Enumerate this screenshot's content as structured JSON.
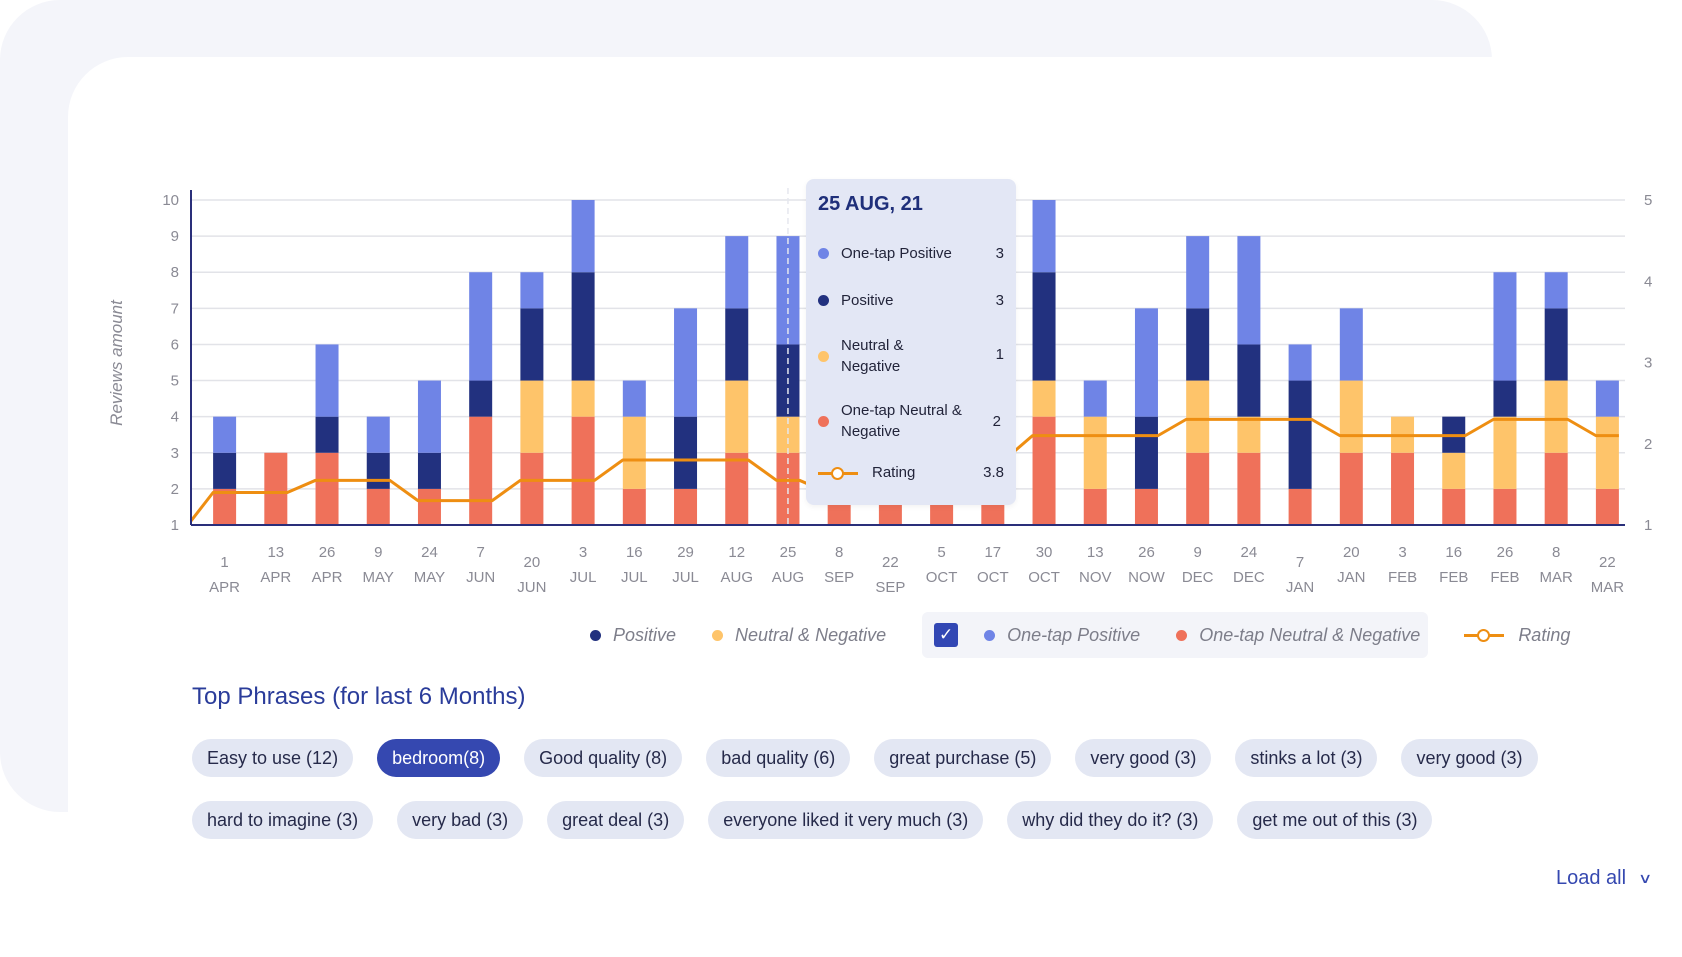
{
  "chart_data": {
    "type": "bar",
    "stacked": true,
    "ylabel": "Reviews amount",
    "ylim": [
      1,
      10
    ],
    "yticks": [
      1,
      2,
      3,
      4,
      5,
      6,
      7,
      8,
      9,
      10
    ],
    "y2lim": [
      1,
      5
    ],
    "y2ticks": [
      1,
      2,
      3,
      4,
      5
    ],
    "grid": true,
    "legend_position": "bottom-right",
    "categories": [
      {
        "day": "1",
        "month": "APR"
      },
      {
        "day": "13",
        "month": "APR"
      },
      {
        "day": "26",
        "month": "APR"
      },
      {
        "day": "9",
        "month": "MAY"
      },
      {
        "day": "24",
        "month": "MAY"
      },
      {
        "day": "7",
        "month": "JUN"
      },
      {
        "day": "20",
        "month": "JUN"
      },
      {
        "day": "3",
        "month": "JUL"
      },
      {
        "day": "16",
        "month": "JUL"
      },
      {
        "day": "29",
        "month": "JUL"
      },
      {
        "day": "12",
        "month": "AUG"
      },
      {
        "day": "25",
        "month": "AUG"
      },
      {
        "day": "8",
        "month": "SEP"
      },
      {
        "day": "22",
        "month": "SEP"
      },
      {
        "day": "5",
        "month": "OCT"
      },
      {
        "day": "17",
        "month": "OCT"
      },
      {
        "day": "30",
        "month": "OCT"
      },
      {
        "day": "13",
        "month": "NOV"
      },
      {
        "day": "26",
        "month": "NOW"
      },
      {
        "day": "9",
        "month": "DEC"
      },
      {
        "day": "24",
        "month": "DEC"
      },
      {
        "day": "7",
        "month": "JAN"
      },
      {
        "day": "20",
        "month": "JAN"
      },
      {
        "day": "3",
        "month": "FEB"
      },
      {
        "day": "16",
        "month": "FEB"
      },
      {
        "day": "26",
        "month": "FEB"
      },
      {
        "day": "8",
        "month": "MAR"
      },
      {
        "day": "22",
        "month": "MAR"
      }
    ],
    "series": [
      {
        "name": "One-tap Neutral & Negative",
        "color": "#ef715a",
        "values": [
          1,
          2,
          2,
          1,
          1,
          3,
          2,
          3,
          1,
          1,
          2,
          2,
          1,
          1,
          1,
          1,
          3,
          1,
          1,
          2,
          2,
          1,
          2,
          2,
          1,
          1,
          2,
          1
        ]
      },
      {
        "name": "Neutral & Negative",
        "color": "#fec46a",
        "values": [
          0,
          0,
          0,
          0,
          0,
          0,
          2,
          1,
          2,
          0,
          2,
          1,
          0,
          0,
          0,
          0,
          1,
          2,
          0,
          2,
          1,
          0,
          2,
          1,
          1,
          2,
          2,
          2
        ]
      },
      {
        "name": "Positive",
        "color": "#22317f",
        "values": [
          1,
          0,
          1,
          1,
          1,
          1,
          2,
          3,
          0,
          2,
          2,
          2,
          0,
          0,
          0,
          0,
          3,
          0,
          2,
          2,
          2,
          3,
          0,
          0,
          1,
          1,
          2,
          0
        ]
      },
      {
        "name": "One-tap Positive",
        "color": "#6f84e6",
        "values": [
          1,
          0,
          2,
          1,
          2,
          3,
          1,
          2,
          1,
          3,
          2,
          3,
          0,
          0,
          0,
          0,
          2,
          1,
          3,
          2,
          3,
          1,
          2,
          0,
          0,
          3,
          1,
          1
        ]
      }
    ],
    "rating": {
      "name": "Rating",
      "color": "#ee8e12",
      "values": [
        1.4,
        1.4,
        1.55,
        1.55,
        1.3,
        1.3,
        1.55,
        1.55,
        1.8,
        1.8,
        1.8,
        1.55,
        1.4,
        1.4,
        1.55,
        1.8,
        2.1,
        2.1,
        2.1,
        2.3,
        2.3,
        2.3,
        2.1,
        2.1,
        2.1,
        2.3,
        2.3,
        2.1
      ]
    },
    "highlight_index": 11
  },
  "tooltip": {
    "title": "25 AUG, 21",
    "rows": [
      {
        "label": "One-tap Positive",
        "value": "3",
        "color": "#6f84e6"
      },
      {
        "label": "Positive",
        "value": "3",
        "color": "#22317f"
      },
      {
        "label": "Neutral & Negative",
        "value": "1",
        "color": "#fec46a"
      },
      {
        "label": "One-tap Neutral & Negative",
        "value": "2",
        "color": "#ef715a"
      }
    ],
    "rating_label": "Rating",
    "rating_value": "3.8"
  },
  "legend": {
    "positive": "Positive",
    "neutral_negative": "Neutral & Negative",
    "one_tap_checked": true,
    "one_tap_positive": "One-tap Positive",
    "one_tap_neutral_negative": "One-tap Neutral & Negative",
    "rating": "Rating"
  },
  "phrases": {
    "title": "Top Phrases (for last 6 Months)",
    "row1": [
      {
        "label": "Easy to use (12)",
        "active": false
      },
      {
        "label": "bedroom(8)",
        "active": true
      },
      {
        "label": "Good quality (8)",
        "active": false
      },
      {
        "label": "bad quality (6)",
        "active": false
      },
      {
        "label": "great purchase (5)",
        "active": false
      },
      {
        "label": "very good (3)",
        "active": false
      },
      {
        "label": "stinks a lot (3)",
        "active": false
      },
      {
        "label": "very good (3)",
        "active": false
      }
    ],
    "row2": [
      {
        "label": "hard to imagine (3)",
        "active": false
      },
      {
        "label": "very bad (3)",
        "active": false
      },
      {
        "label": "great deal (3)",
        "active": false
      },
      {
        "label": "everyone liked it very much (3)",
        "active": false
      },
      {
        "label": "why did they do it? (3)",
        "active": false
      },
      {
        "label": "get me out of this (3)",
        "active": false
      }
    ],
    "load_all": "Load all"
  }
}
